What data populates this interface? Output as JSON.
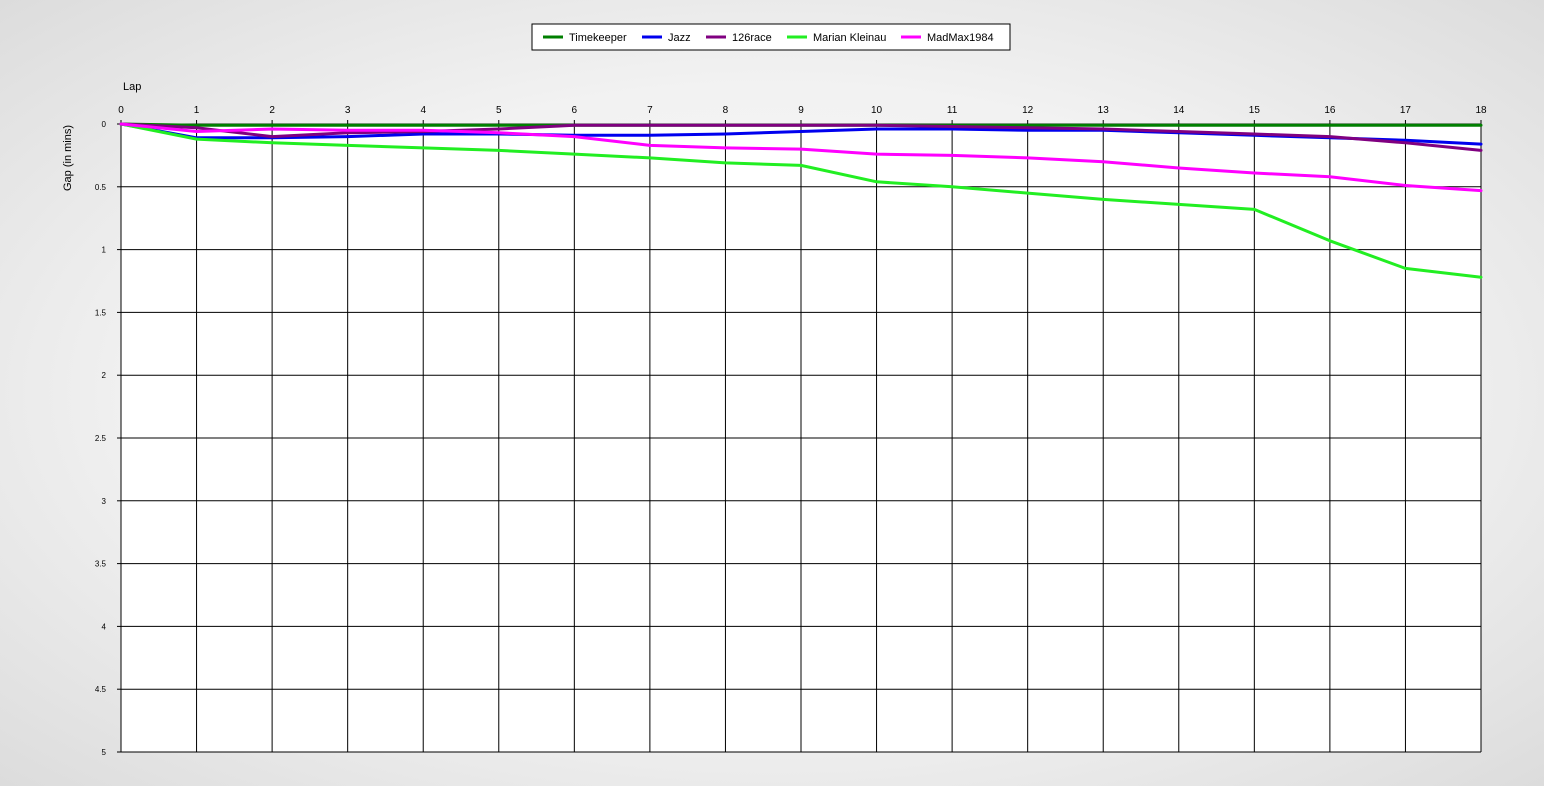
{
  "chart_data": {
    "type": "line",
    "title": "",
    "xlabel": "Lap",
    "ylabel": "Gap (in mins)",
    "x": [
      0,
      1,
      2,
      3,
      4,
      5,
      6,
      7,
      8,
      9,
      10,
      11,
      12,
      13,
      14,
      15,
      16,
      17,
      18
    ],
    "x_ticks": [
      "0",
      "1",
      "2",
      "3",
      "4",
      "5",
      "6",
      "7",
      "8",
      "9",
      "10",
      "11",
      "12",
      "13",
      "14",
      "15",
      "16",
      "17",
      "18"
    ],
    "xlim": [
      0,
      18
    ],
    "y_ticks": [
      "0",
      "0.5",
      "1",
      "1.5",
      "2",
      "2.5",
      "3",
      "3.5",
      "4",
      "4.5",
      "5"
    ],
    "ylim": [
      0,
      5
    ],
    "y_inverted": true,
    "x_axis_position": "top",
    "grid": true,
    "legend_position": "top-center",
    "series": [
      {
        "name": "Timekeeper",
        "color": "#007f00",
        "values": [
          0,
          0.01,
          0.01,
          0.01,
          0.01,
          0.01,
          0.01,
          0.01,
          0.01,
          0.01,
          0.01,
          0.01,
          0.01,
          0.01,
          0.01,
          0.01,
          0.01,
          0.01,
          0.01
        ]
      },
      {
        "name": "Jazz",
        "color": "#0000ee",
        "values": [
          0,
          0.11,
          0.11,
          0.1,
          0.08,
          0.08,
          0.09,
          0.09,
          0.08,
          0.06,
          0.04,
          0.04,
          0.05,
          0.05,
          0.07,
          0.09,
          0.11,
          0.13,
          0.16
        ]
      },
      {
        "name": "126race",
        "color": "#800080",
        "values": [
          0,
          0.03,
          0.1,
          0.07,
          0.06,
          0.04,
          0.01,
          0.01,
          0.01,
          0.01,
          0.01,
          0.02,
          0.03,
          0.04,
          0.06,
          0.08,
          0.1,
          0.15,
          0.21
        ]
      },
      {
        "name": "Marian Kleinau",
        "color": "#22ee22",
        "values": [
          0,
          0.12,
          0.15,
          0.17,
          0.19,
          0.21,
          0.24,
          0.27,
          0.31,
          0.33,
          0.46,
          0.5,
          0.55,
          0.6,
          0.64,
          0.68,
          0.93,
          1.15,
          1.22
        ]
      },
      {
        "name": "MadMax1984",
        "color": "#ff00ff",
        "values": [
          0,
          0.06,
          0.04,
          0.05,
          0.05,
          0.07,
          0.1,
          0.17,
          0.19,
          0.2,
          0.24,
          0.25,
          0.27,
          0.3,
          0.35,
          0.39,
          0.42,
          0.49,
          0.53
        ]
      }
    ]
  }
}
